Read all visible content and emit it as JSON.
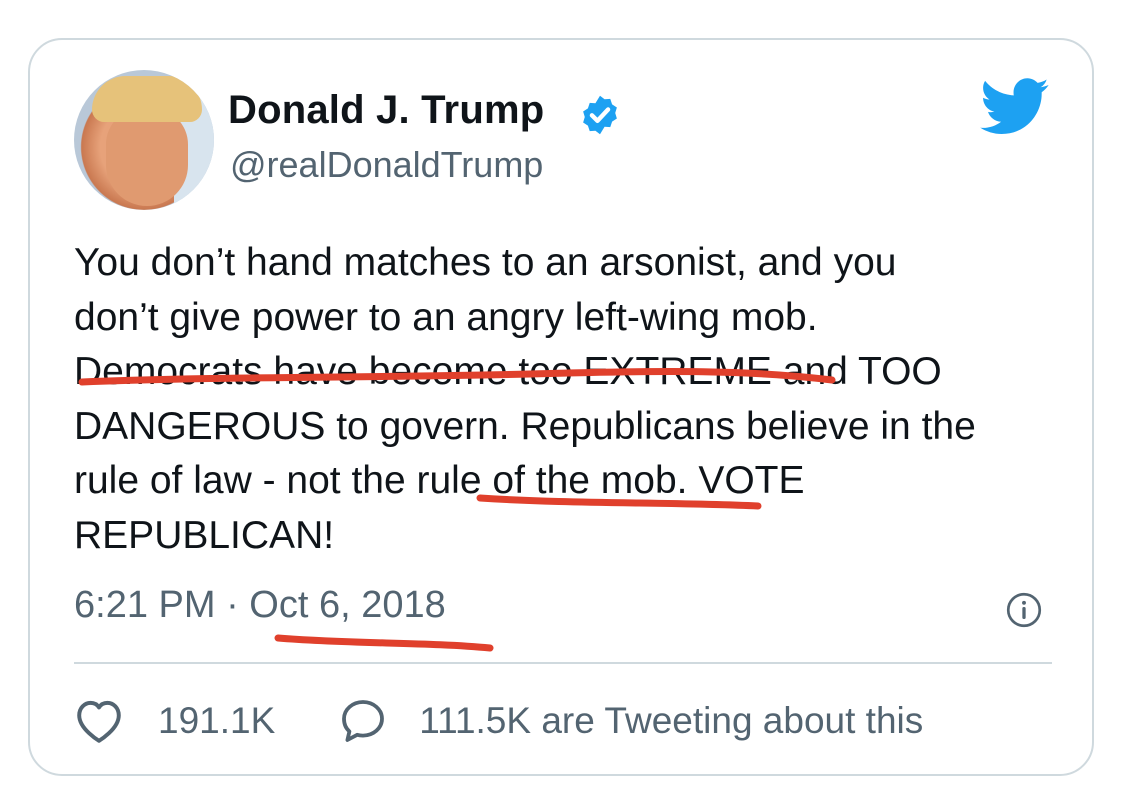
{
  "author": {
    "name": "Donald J. Trump",
    "handle": "@realDonaldTrump",
    "verified": true
  },
  "tweet": {
    "lines": [
      "You don’t hand matches to an arsonist, and you",
      "don’t give power to an angry left-wing mob.",
      "Democrats have become too EXTREME and TOO",
      "DANGEROUS to govern. Republicans believe in the",
      "rule of law - not the rule of the mob. VOTE",
      "REPUBLICAN!"
    ],
    "time": "6:21 PM · Oct 6, 2018"
  },
  "stats": {
    "likes": "191.1K",
    "tweeting": "111.5K are Tweeting about this"
  },
  "icons": {
    "brand": "twitter-bird-icon",
    "verified": "verified-badge-icon",
    "info": "info-icon",
    "like": "heart-icon",
    "reply": "speech-bubble-icon"
  },
  "colors": {
    "text": "#0f1419",
    "secondary": "#536471",
    "accent": "#1da1f2",
    "annotation": "#e0402c",
    "border": "#cfd9de"
  }
}
